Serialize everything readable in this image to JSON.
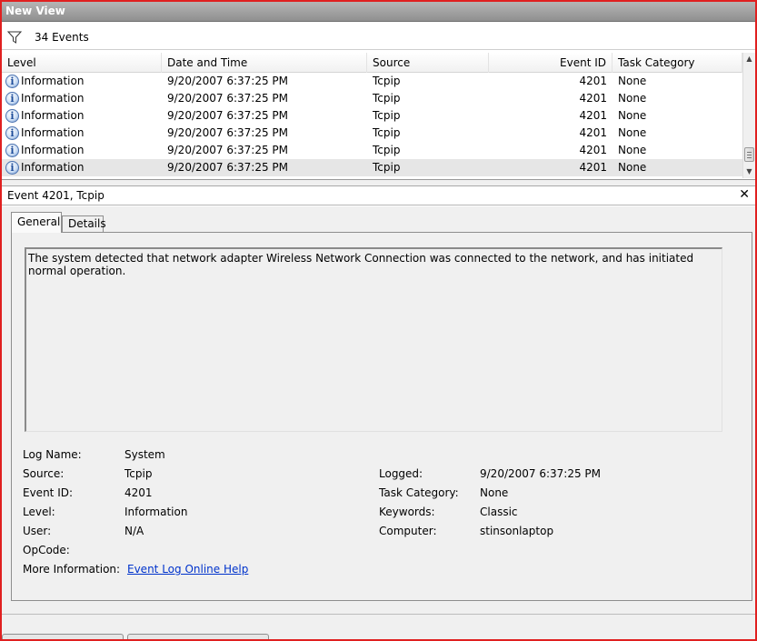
{
  "window": {
    "title": "New View"
  },
  "filter": {
    "icon": "funnel-icon",
    "count_label": "34 Events"
  },
  "grid": {
    "columns": [
      "Level",
      "Date and Time",
      "Source",
      "Event ID",
      "Task Category"
    ],
    "rows": [
      {
        "level": "Information",
        "datetime": "9/20/2007 6:37:25 PM",
        "source": "Tcpip",
        "event_id": "4201",
        "category": "None"
      },
      {
        "level": "Information",
        "datetime": "9/20/2007 6:37:25 PM",
        "source": "Tcpip",
        "event_id": "4201",
        "category": "None"
      },
      {
        "level": "Information",
        "datetime": "9/20/2007 6:37:25 PM",
        "source": "Tcpip",
        "event_id": "4201",
        "category": "None"
      },
      {
        "level": "Information",
        "datetime": "9/20/2007 6:37:25 PM",
        "source": "Tcpip",
        "event_id": "4201",
        "category": "None"
      },
      {
        "level": "Information",
        "datetime": "9/20/2007 6:37:25 PM",
        "source": "Tcpip",
        "event_id": "4201",
        "category": "None"
      },
      {
        "level": "Information",
        "datetime": "9/20/2007 6:37:25 PM",
        "source": "Tcpip",
        "event_id": "4201",
        "category": "None"
      }
    ]
  },
  "detail": {
    "header": "Event 4201, Tcpip",
    "close_glyph": "✕",
    "tabs": [
      "General",
      "Details"
    ],
    "description": "The system detected that network adapter Wireless Network Connection was connected to the network, and has initiated normal operation.",
    "fields": {
      "log_name_label": "Log Name:",
      "log_name": "System",
      "source_label": "Source:",
      "source": "Tcpip",
      "event_id_label": "Event ID:",
      "event_id": "4201",
      "level_label": "Level:",
      "level": "Information",
      "user_label": "User:",
      "user": "N/A",
      "opcode_label": "OpCode:",
      "opcode": "",
      "more_info_label": "More Information:",
      "more_info_link": "Event Log Online Help",
      "logged_label": "Logged:",
      "logged": "9/20/2007 6:37:25 PM",
      "task_category_label": "Task Category:",
      "task_category": "None",
      "keywords_label": "Keywords:",
      "keywords": "Classic",
      "computer_label": "Computer:",
      "computer": "stinsonlaptop"
    }
  },
  "colors": {
    "frame": "#e02020",
    "link": "#0033cc",
    "title_bar": "#a0a0a0"
  }
}
